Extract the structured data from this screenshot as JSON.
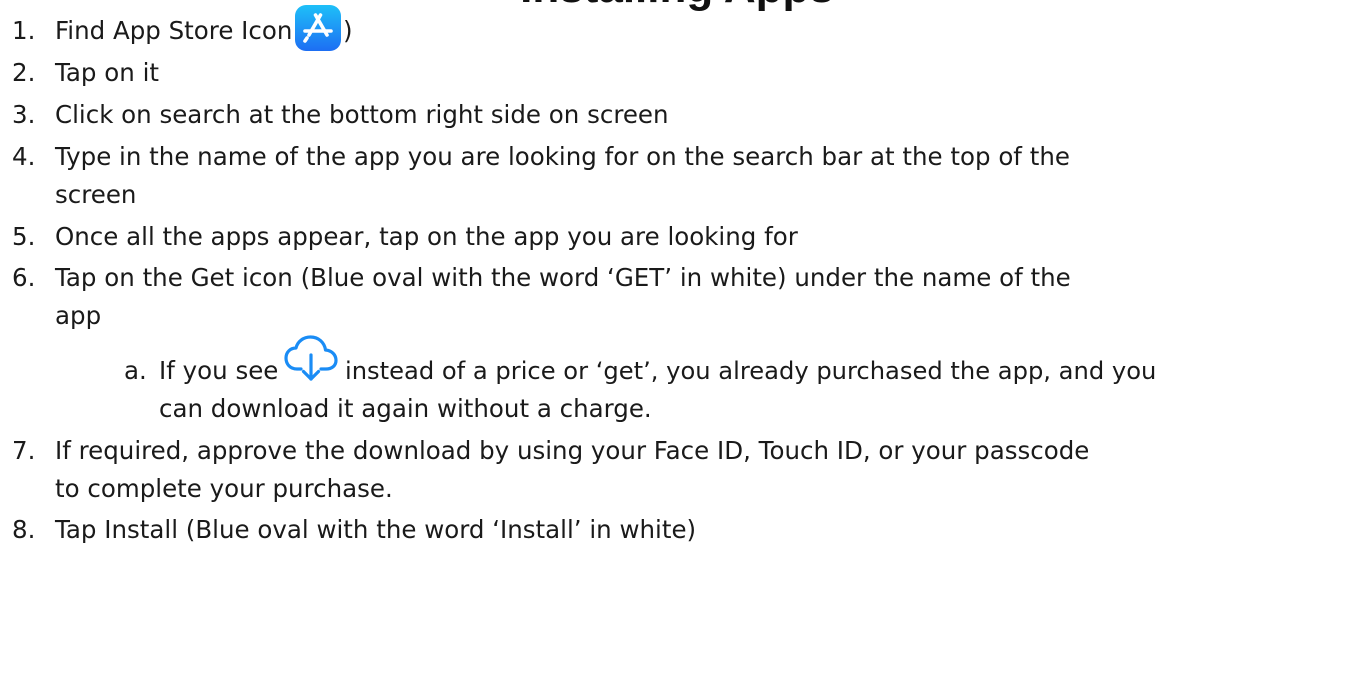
{
  "document": {
    "title_clipped": "Installing Apps",
    "steps": [
      {
        "num": "1.",
        "text_before_icon": "Find App Store Icon (",
        "text_after_icon": ")"
      },
      {
        "num": "2.",
        "text": "Tap on it"
      },
      {
        "num": "3.",
        "text": "Click on search at the bottom right side on screen"
      },
      {
        "num": "4.",
        "text": "Type in the name of the app you are looking for on the search bar at the top of the",
        "cont": "screen"
      },
      {
        "num": "5.",
        "text": "Once all the apps appear, tap on the app you are looking for"
      },
      {
        "num": "6.",
        "text": "Tap on the Get icon (Blue oval with the word ‘GET’ in white) under the name of the",
        "cont": "app"
      },
      {
        "num": "7.",
        "text": "If required, approve the download by using your Face ID, Touch ID, or your passcode",
        "cont": "to complete your purchase."
      },
      {
        "num": "8.",
        "text": "Tap Install (Blue oval with the word ‘Install’ in white)"
      }
    ],
    "substep": {
      "letter": "a.",
      "text_before_icon": "If you see",
      "text_after_icon": "instead of a price or ‘get’, you already purchased the app, and you",
      "cont": "can download it again without a charge."
    },
    "icons": {
      "app_store": "app-store-icon",
      "cloud_download": "cloud-download-icon"
    },
    "colors": {
      "app_store_top": "#1ec0f8",
      "app_store_bottom": "#1d6ef3",
      "cloud_blue": "#1a8cf5"
    }
  }
}
